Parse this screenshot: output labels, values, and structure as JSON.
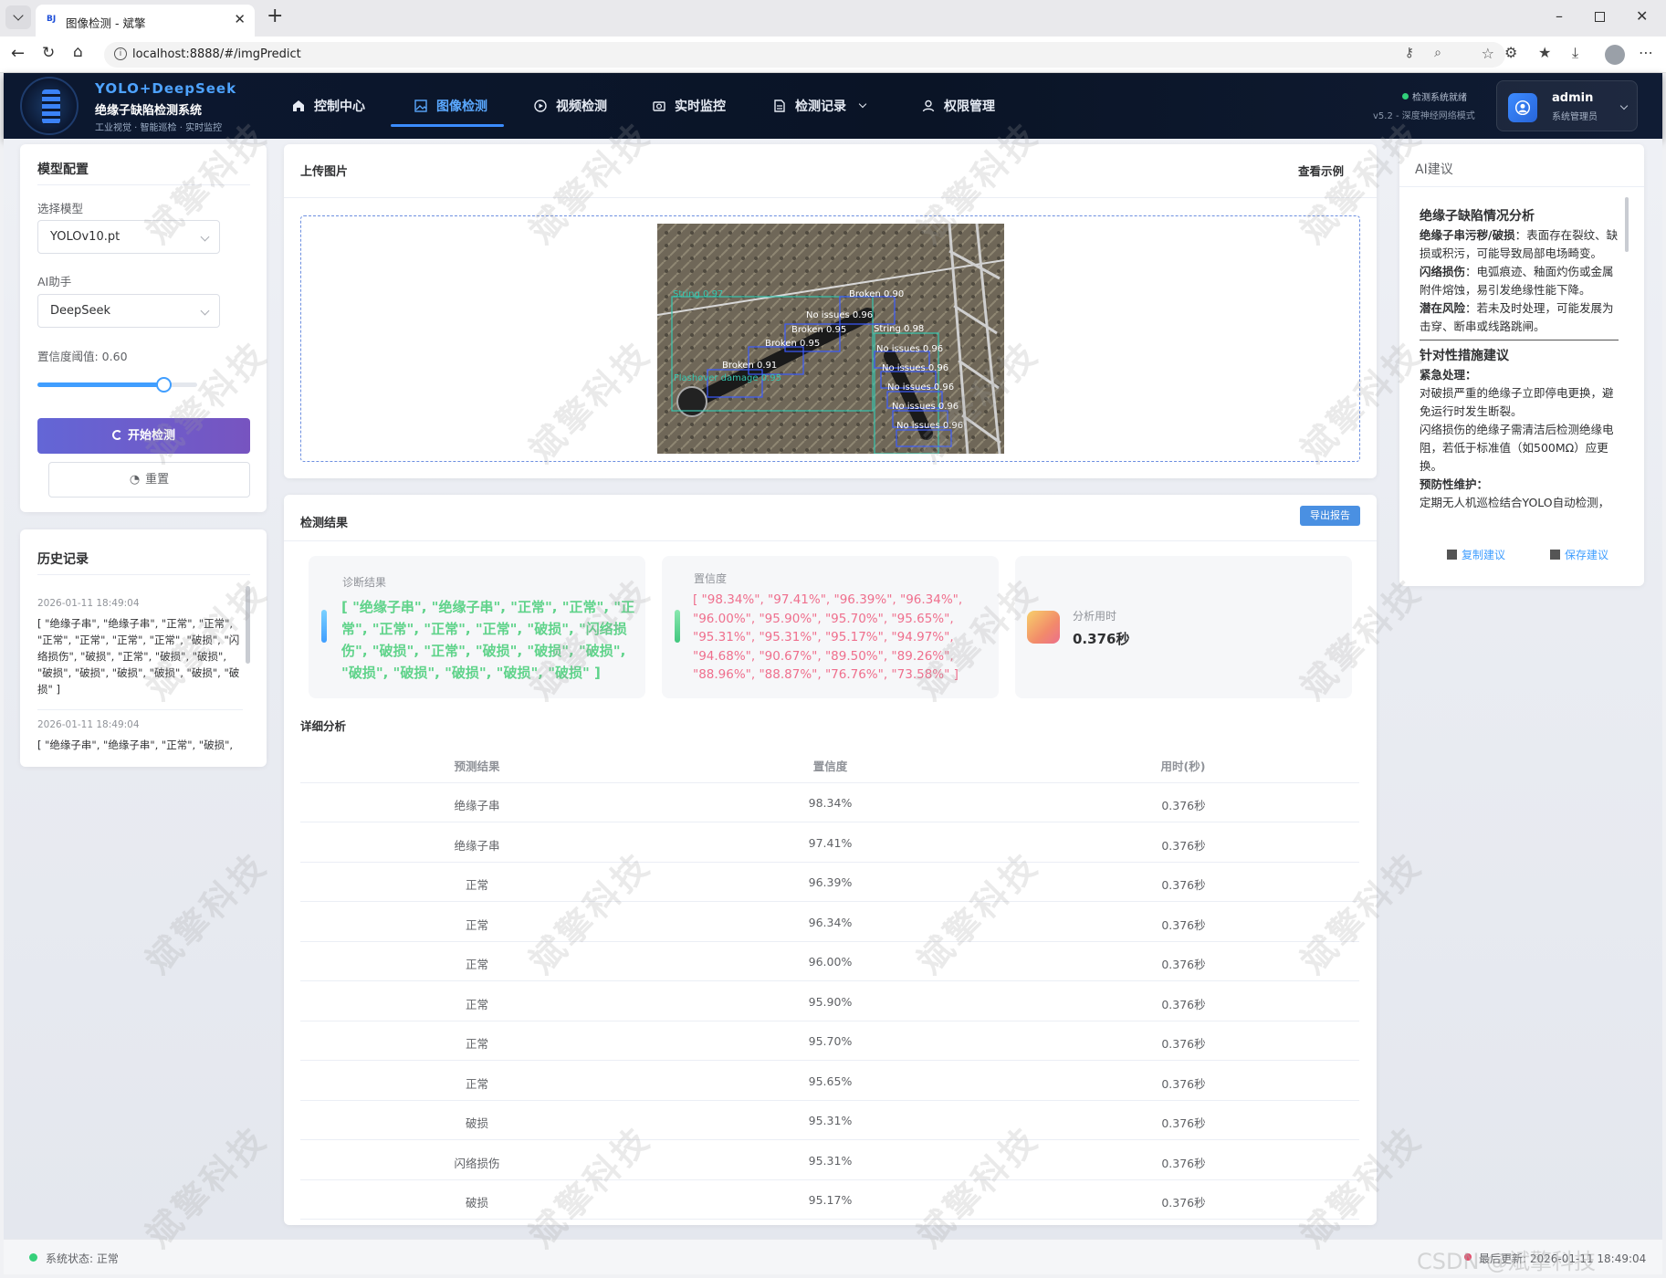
{
  "browser": {
    "tab_title": "图像检测 - 斌擎",
    "url": "localhost:8888/#/imgPredict"
  },
  "header": {
    "brand": "YOLO+DeepSeek",
    "system_name": "绝缘子缺陷检测系统",
    "tagline": "工业视觉 · 智能巡检 · 实时监控",
    "nav": [
      "控制中心",
      "图像检测",
      "视频检测",
      "实时监控",
      "检测记录",
      "权限管理"
    ],
    "active_nav": "图像检测",
    "status_text": "检测系统就绪",
    "version_text": "v5.2 - 深度神经网络模式",
    "user_name": "admin",
    "user_role": "系统管理员"
  },
  "model_config": {
    "title": "模型配置",
    "model_label": "选择模型",
    "model_value": "YOLOv10.pt",
    "assistant_label": "AI助手",
    "assistant_value": "DeepSeek",
    "threshold_label": "置信度阈值: 0.60",
    "threshold_value": 0.6,
    "start_button": "开始检测",
    "reset_button": "重置"
  },
  "history": {
    "title": "历史记录",
    "items": [
      {
        "time": "2026-01-11 18:49:04",
        "text": "[ \"绝缘子串\", \"绝缘子串\", \"正常\", \"正常\", \"正常\", \"正常\", \"正常\", \"正常\", \"破损\", \"闪络损伤\", \"破损\", \"正常\", \"破损\", \"破损\", \"破损\", \"破损\", \"破损\", \"破损\", \"破损\", \"破损\" ]"
      },
      {
        "time": "2026-01-11 18:49:04",
        "text": "[ \"绝缘子串\", \"绝缘子串\", \"正常\", \"破损\","
      }
    ]
  },
  "upload": {
    "title": "上传图片",
    "example_link": "查看示例",
    "detections": [
      "String 0.97",
      "Broken 0.90",
      "No issues 0.96",
      "Broken 0.95",
      "String 0.98",
      "No issues 0.96",
      "Broken 0.95",
      "No issues 0.96",
      "Broken 0.91",
      "No issues 0.96",
      "Flashover damage 0.95",
      "No issues 0.96",
      "No issues 0.96"
    ]
  },
  "results": {
    "title": "检测结果",
    "export_button": "导出报告",
    "diagnosis_label": "诊断结果",
    "diagnosis_text": "[ \"绝缘子串\", \"绝缘子串\", \"正常\", \"正常\", \"正常\", \"正常\", \"正常\", \"正常\", \"破损\", \"闪络损伤\", \"破损\", \"正常\", \"破损\", \"破损\", \"破损\", \"破损\", \"破损\", \"破损\", \"破损\", \"破损\" ]",
    "confidence_label": "置信度",
    "confidence_text": "[ \"98.34%\", \"97.41%\", \"96.39%\", \"96.34%\", \"96.00%\", \"95.90%\", \"95.70%\", \"95.65%\", \"95.31%\", \"95.31%\", \"95.17%\", \"94.97%\", \"94.68%\", \"90.67%\", \"89.50%\", \"89.26%\", \"88.96%\", \"88.87%\", \"76.76%\", \"73.58%\" ]",
    "time_label": "分析用时",
    "time_value": "0.376秒",
    "detail_title": "详细分析",
    "table_headers": [
      "预测结果",
      "置信度",
      "用时(秒)"
    ],
    "table_rows": [
      [
        "绝缘子串",
        "98.34%",
        "0.376秒"
      ],
      [
        "绝缘子串",
        "97.41%",
        "0.376秒"
      ],
      [
        "正常",
        "96.39%",
        "0.376秒"
      ],
      [
        "正常",
        "96.34%",
        "0.376秒"
      ],
      [
        "正常",
        "96.00%",
        "0.376秒"
      ],
      [
        "正常",
        "95.90%",
        "0.376秒"
      ],
      [
        "正常",
        "95.70%",
        "0.376秒"
      ],
      [
        "正常",
        "95.65%",
        "0.376秒"
      ],
      [
        "破损",
        "95.31%",
        "0.376秒"
      ],
      [
        "闪络损伤",
        "95.31%",
        "0.376秒"
      ],
      [
        "破损",
        "95.17%",
        "0.376秒"
      ]
    ]
  },
  "ai": {
    "title": "AI建议",
    "heading1": "绝缘子缺陷情况分析",
    "item1_bold": "绝缘子串污秽/破损",
    "item1_text": "：表面存在裂纹、缺损或积污，可能导致局部电场畸变。",
    "item2_bold": "闪络损伤",
    "item2_text": "：电弧痕迹、釉面灼伤或金属附件熔蚀，易引发绝缘性能下降。",
    "item3_bold": "潜在风险",
    "item3_text": "：若未及时处理，可能发展为击穿、断串或线路跳闸。",
    "heading2": "针对性措施建议",
    "item4_bold": "紧急处理：",
    "item4_line1": "对破损严重的绝缘子立即停电更换，避免运行时发生断裂。",
    "item4_line2": "闪络损伤的绝缘子需清洁后检测绝缘电阻，若低于标准值（如500MΩ）应更换。",
    "item5_bold": "预防性维护：",
    "item5_line1": "定期无人机巡检结合YOLO自动检测，",
    "copy_button": "复制建议",
    "save_button": "保存建议"
  },
  "footer": {
    "status": "系统状态: 正常",
    "last_update": "最后更新: 2026-01-11 18:49:04",
    "csdn": "CSDN @斌擎科技"
  },
  "watermark": "斌擎科技",
  "colors": {
    "accent": "#409eff",
    "start_button": "#6c6fd4",
    "diagnosis_text": "#5fd38a",
    "confidence_text": "#ef6f8d",
    "header_bg": "#0c1830"
  }
}
